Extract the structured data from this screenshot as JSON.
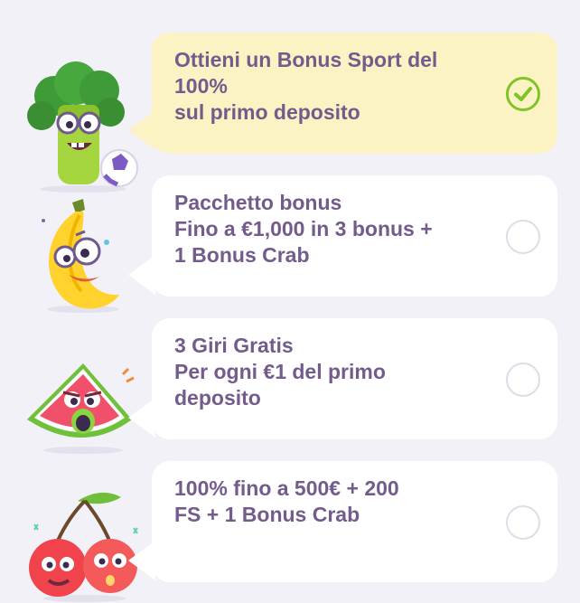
{
  "options": [
    {
      "mascot": "broccoli-with-football-icon",
      "lines": [
        "Ottieni un Bonus Sport del",
        "100%",
        "sul primo deposito"
      ],
      "selected": true
    },
    {
      "mascot": "banana-icon",
      "lines": [
        "Pacchetto bonus",
        "Fino a €1,000 in 3 bonus +",
        "1 Bonus Crab"
      ],
      "selected": false
    },
    {
      "mascot": "watermelon-icon",
      "lines": [
        "3 Giri Gratis",
        "Per ogni €1 del primo",
        "deposito"
      ],
      "selected": false
    },
    {
      "mascot": "cherries-icon",
      "lines": [
        "100% fino a 500€ + 200",
        "FS + 1 Bonus Crab"
      ],
      "selected": false
    }
  ],
  "colors": {
    "background": "#f2f1f8",
    "selected_bubble": "#fcf3c5",
    "bubble": "#ffffff",
    "text": "#735c8c",
    "check": "#7ec424",
    "radio_border": "#dedce6"
  }
}
